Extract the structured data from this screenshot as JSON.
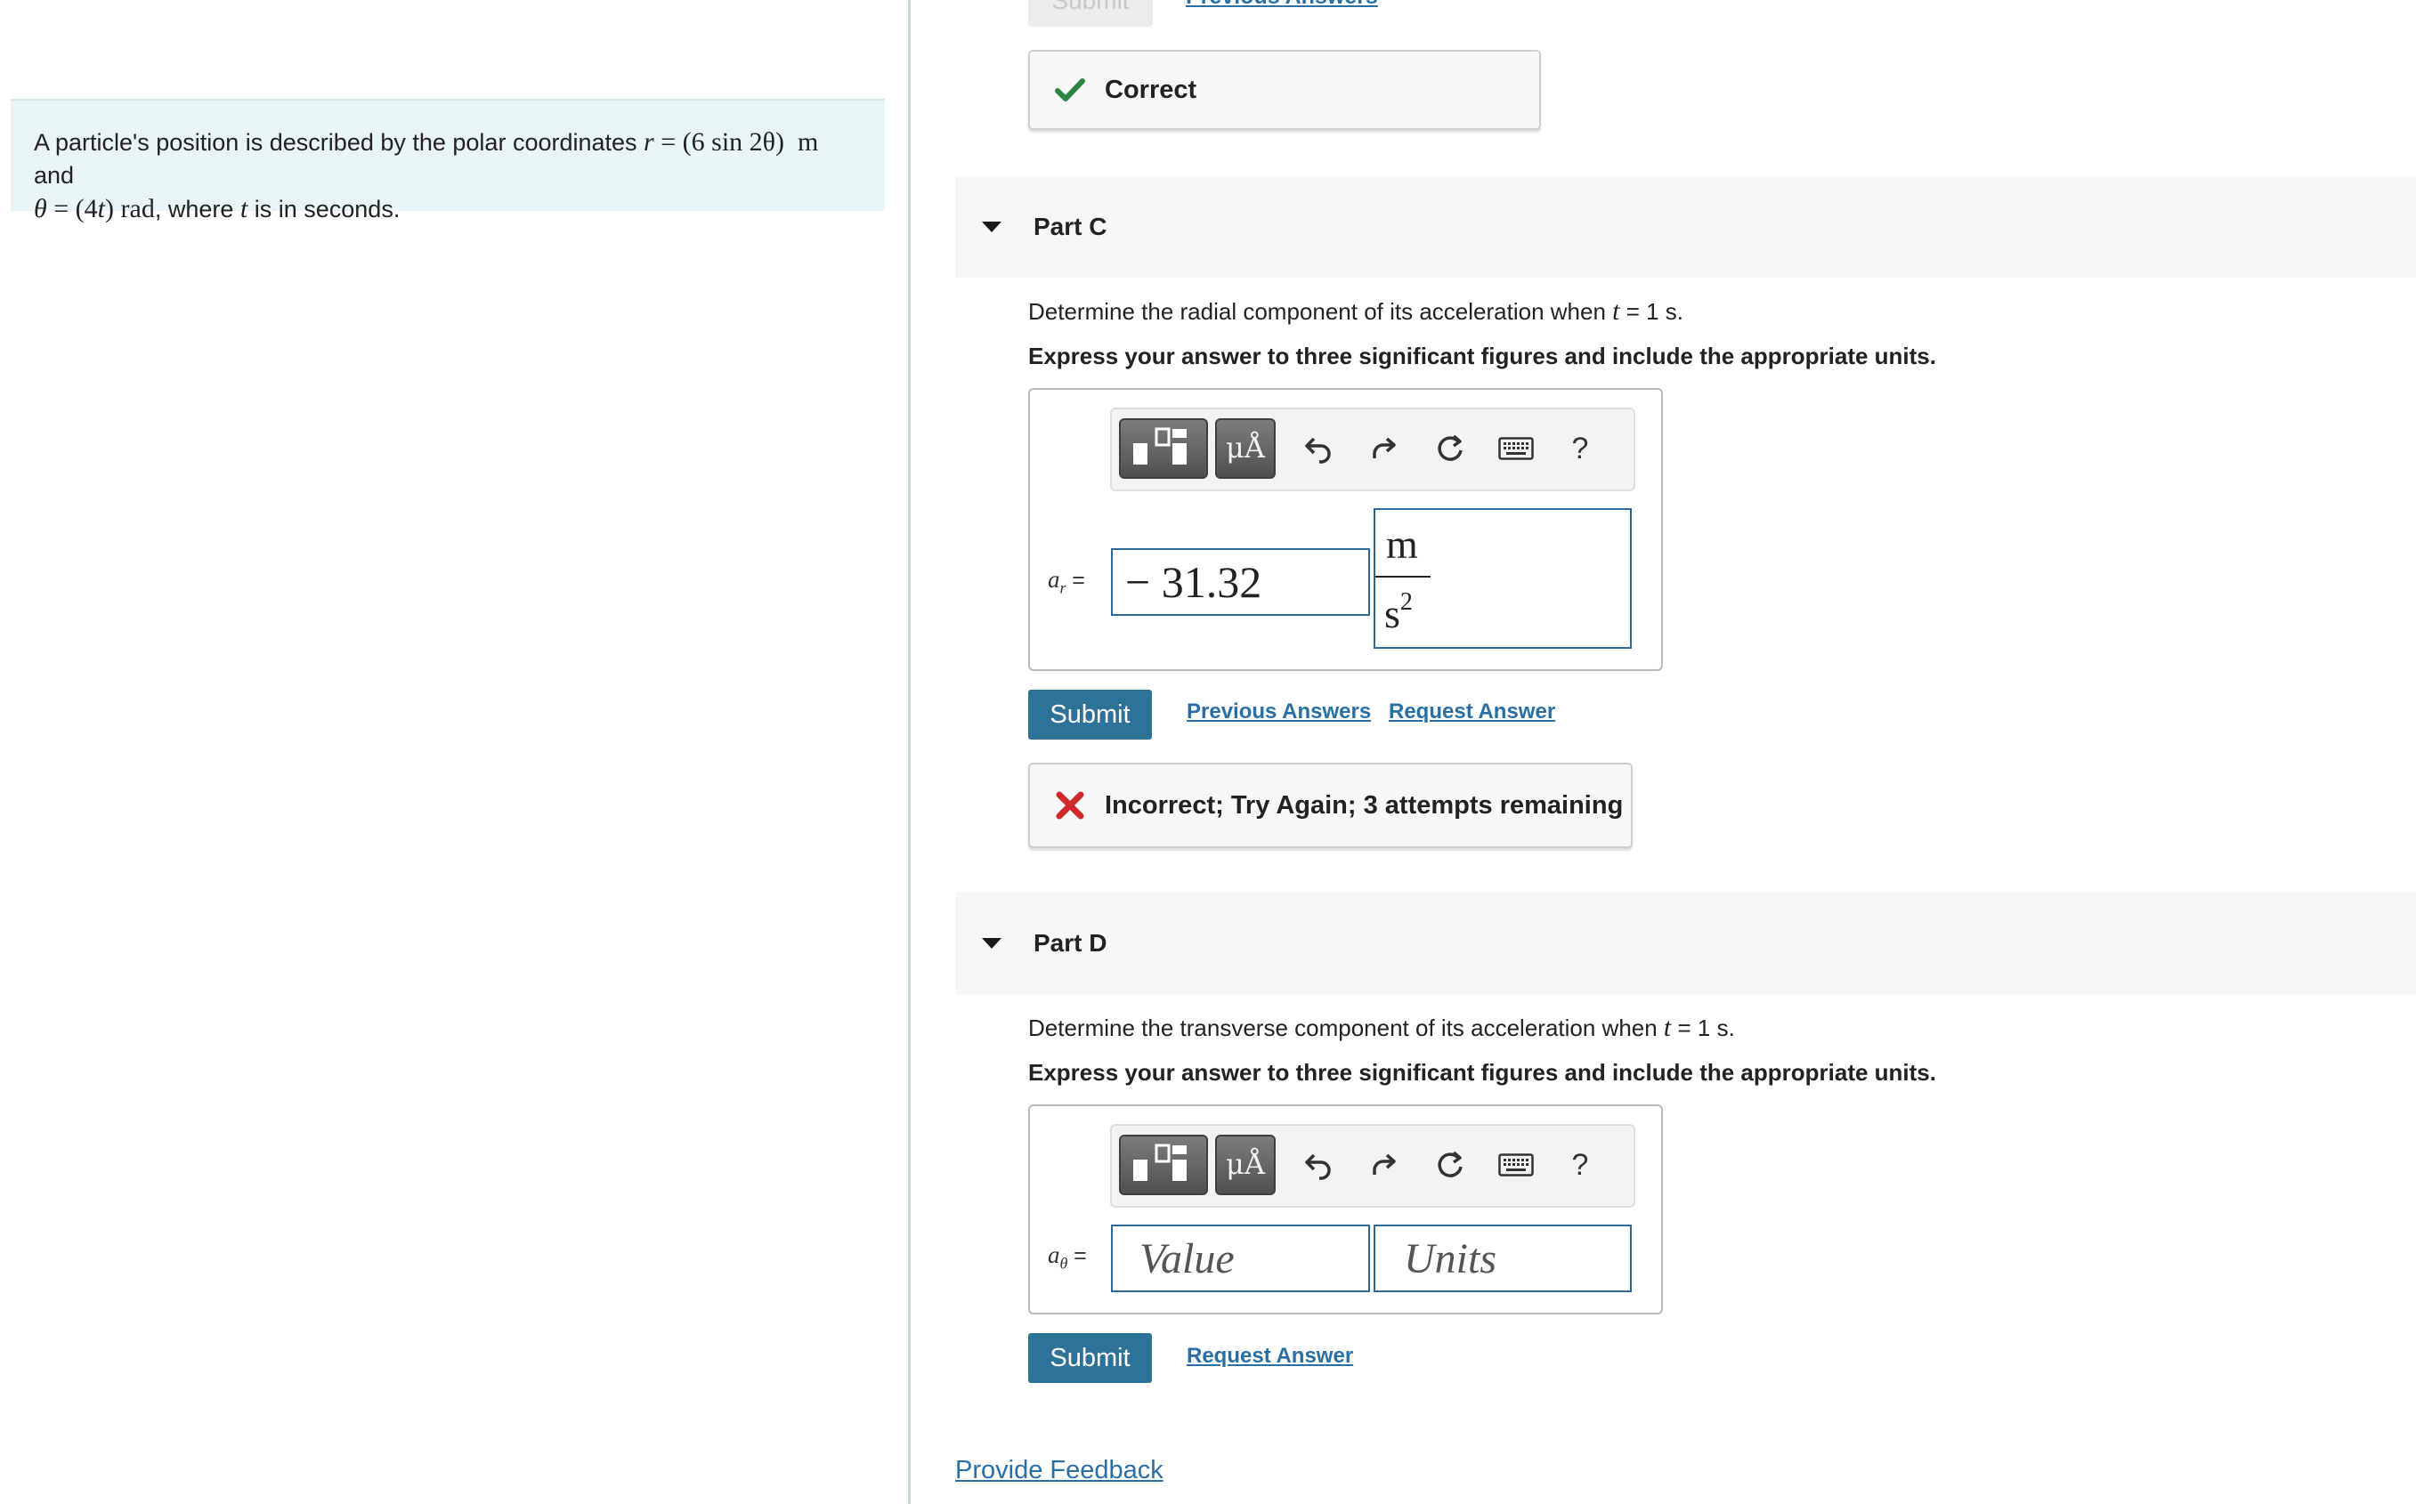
{
  "problem": {
    "text_before": "A particle's position is described by the polar coordinates ",
    "r_var": "r",
    "eq": " = ",
    "r_expr": "(6 sin 2θ)",
    "r_unit": "m",
    "and": " and",
    "theta_var": "θ",
    "theta_expr": "(4",
    "t_var": "t",
    "theta_close": ")",
    "theta_unit": "rad",
    "text_after": ", where ",
    "t_var2": "t",
    "text_end": " is in seconds."
  },
  "top_remnant": {
    "submit_label": "Submit",
    "link_label": "Previous Answers"
  },
  "part_b_feedback": {
    "label": "Correct",
    "status_color": "#2e8540"
  },
  "part_c": {
    "title": "Part C",
    "question_before": "Determine the radial component of its acceleration when ",
    "question_var": "t",
    "question_after": " = 1 s.",
    "instructions": "Express your answer to three significant figures and include the appropriate units.",
    "toolbar": {
      "units_label": "μÅ",
      "help_label": "?"
    },
    "variable": "a",
    "variable_sub": "r",
    "equals": "=",
    "value": "− 31.32",
    "unit_numerator": "m",
    "unit_denominator": "s",
    "unit_exponent": "2",
    "submit_label": "Submit",
    "previous_answers_label": "Previous Answers",
    "request_answer_label": "Request Answer",
    "feedback": {
      "label": "Incorrect; Try Again; 3 attempts remaining",
      "status_color": "#d0292c"
    }
  },
  "part_d": {
    "title": "Part D",
    "question_before": "Determine the transverse component of its acceleration when ",
    "question_var": "t",
    "question_after": " = 1 s.",
    "instructions": "Express your answer to three significant figures and include the appropriate units.",
    "toolbar": {
      "units_label": "μÅ",
      "help_label": "?"
    },
    "variable": "a",
    "variable_sub": "θ",
    "equals": "=",
    "value_placeholder": "Value",
    "units_placeholder": "Units",
    "submit_label": "Submit",
    "request_answer_label": "Request Answer"
  },
  "footer": {
    "feedback_link": "Provide Feedback"
  },
  "colors": {
    "accent": "#2f7297",
    "link": "#2a6fa3",
    "problem_bg": "#e9f4f6",
    "part_header_bg": "#f7f7f7"
  }
}
